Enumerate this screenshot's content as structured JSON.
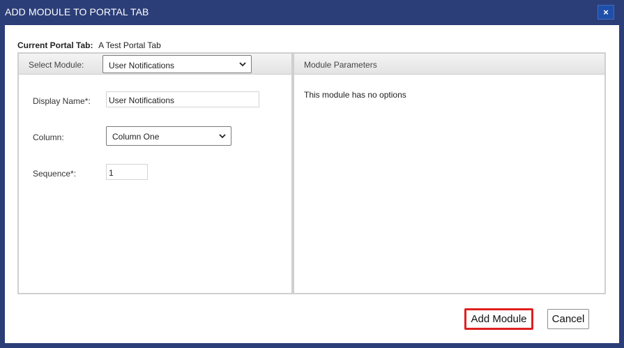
{
  "dialog": {
    "title": "ADD MODULE TO PORTAL TAB",
    "close_label": "×"
  },
  "current_tab": {
    "label": "Current Portal Tab:",
    "value": "A Test Portal Tab"
  },
  "left_panel": {
    "select_module_label": "Select Module:",
    "select_module_value": "User Notifications",
    "display_name_label": "Display Name*:",
    "display_name_value": "User Notifications",
    "column_label": "Column:",
    "column_value": "Column One",
    "sequence_label": "Sequence*:",
    "sequence_value": "1"
  },
  "right_panel": {
    "header": "Module Parameters",
    "message": "This module has no options"
  },
  "buttons": {
    "add_module": "Add Module",
    "cancel": "Cancel"
  },
  "colors": {
    "title_bar": "#2c3e78",
    "highlight": "#e02020"
  },
  "icons": {
    "close": "close-icon",
    "dropdown": "chevron-down-icon"
  }
}
